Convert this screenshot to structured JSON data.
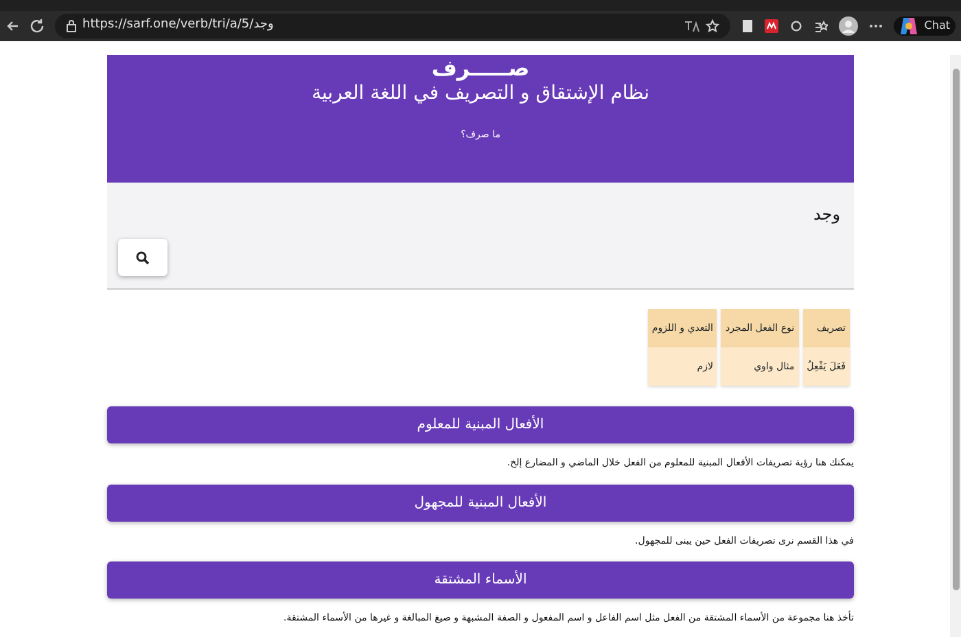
{
  "browser": {
    "url": "https://sarf.one/verb/tri/a/5/وجد",
    "copilot_label": "Chat"
  },
  "header": {
    "logo": "صـــــرف",
    "subtitle": "نظام الإشتقاق و التصريف في اللغة العربية",
    "link": "ما صرف؟"
  },
  "search": {
    "value": "وجد"
  },
  "table": {
    "columns": [
      "تصريف",
      "نوع الفعل المجرد",
      "التعدي و اللزوم"
    ],
    "rows": [
      [
        "فَعَلَ يَفْعِلُ",
        "مثال واوي",
        "لازم"
      ]
    ]
  },
  "sections": [
    {
      "title": "الأفعال المبنية للمعلوم",
      "description": "يمكنك هنا رؤية تصريفات الأفعال المبنية للمعلوم من الفعل خلال الماضي و المضارع إلخ."
    },
    {
      "title": "الأفعال المبنية للمجهول",
      "description": "في هذا القسم نرى تصريفات الفعل حين يبنى للمجهول."
    },
    {
      "title": "الأسماء المشتقة",
      "description": "تأخذ هنا مجموعة من الأسماء المشتقة من الفعل مثل اسم الفاعل و اسم المفعول و الصفة المشبهة و صيغ المبالغة و غيرها من الأسماء المشتقة."
    }
  ]
}
